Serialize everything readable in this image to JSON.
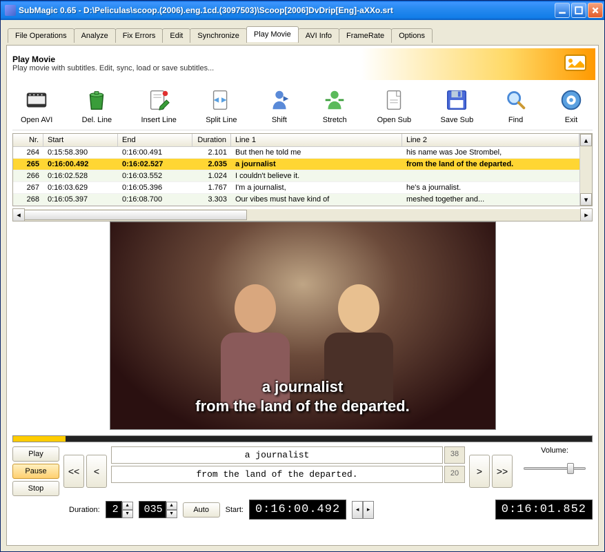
{
  "window": {
    "title": "SubMagic 0.65 - D:\\Peliculas\\scoop.(2006).eng.1cd.(3097503)\\Scoop[2006]DvDrip[Eng]-aXXo.srt"
  },
  "tabs": [
    {
      "label": "File Operations"
    },
    {
      "label": "Analyze"
    },
    {
      "label": "Fix Errors"
    },
    {
      "label": "Edit"
    },
    {
      "label": "Synchronize"
    },
    {
      "label": "Play Movie",
      "active": true
    },
    {
      "label": "AVI Info"
    },
    {
      "label": "FrameRate"
    },
    {
      "label": "Options"
    }
  ],
  "panel": {
    "title": "Play Movie",
    "subtitle": "Play movie with subtitles. Edit, sync, load or save subtitles..."
  },
  "toolbar": [
    {
      "name": "open-avi",
      "label": "Open AVI",
      "icon": "film"
    },
    {
      "name": "del-line",
      "label": "Del. Line",
      "icon": "trash"
    },
    {
      "name": "insert-line",
      "label": "Insert Line",
      "icon": "doc-pencil"
    },
    {
      "name": "split-line",
      "label": "Split Line",
      "icon": "doc-split"
    },
    {
      "name": "shift",
      "label": "Shift",
      "icon": "person-blue"
    },
    {
      "name": "stretch",
      "label": "Stretch",
      "icon": "person-green"
    },
    {
      "name": "open-sub",
      "label": "Open Sub",
      "icon": "doc"
    },
    {
      "name": "save-sub",
      "label": "Save Sub",
      "icon": "floppy"
    },
    {
      "name": "find",
      "label": "Find",
      "icon": "magnify"
    },
    {
      "name": "exit",
      "label": "Exit",
      "icon": "exit"
    }
  ],
  "grid": {
    "headers": {
      "nr": "Nr.",
      "start": "Start",
      "end": "End",
      "dur": "Duration",
      "l1": "Line 1",
      "l2": "Line 2"
    },
    "rows": [
      {
        "nr": "264",
        "start": "0:15:58.390",
        "end": "0:16:00.491",
        "dur": "2.101",
        "l1": "But then he told me",
        "l2": "his name was Joe Strombel,"
      },
      {
        "nr": "265",
        "start": "0:16:00.492",
        "end": "0:16:02.527",
        "dur": "2.035",
        "l1": "a journalist",
        "l2": "from the land of the departed.",
        "sel": true
      },
      {
        "nr": "266",
        "start": "0:16:02.528",
        "end": "0:16:03.552",
        "dur": "1.024",
        "l1": "I couldn't believe it.",
        "l2": "",
        "alt": true
      },
      {
        "nr": "267",
        "start": "0:16:03.629",
        "end": "0:16:05.396",
        "dur": "1.767",
        "l1": "I'm a journalist,",
        "l2": "he's a journalist."
      },
      {
        "nr": "268",
        "start": "0:16:05.397",
        "end": "0:16:08.700",
        "dur": "3.303",
        "l1": "Our vibes must have kind of",
        "l2": "meshed together and...",
        "alt": true
      }
    ]
  },
  "video_subtitle": {
    "l1": "a journalist",
    "l2": "from the land of the departed."
  },
  "playback": {
    "play": "Play",
    "pause": "Pause",
    "stop": "Stop",
    "prev_fast": "<<",
    "prev": "<",
    "next": ">",
    "next_fast": ">>",
    "line1": {
      "text": "a journalist",
      "chars": "38"
    },
    "line2": {
      "text": "from the land of the departed.",
      "chars": "20"
    },
    "volume_label": "Volume:"
  },
  "bottom": {
    "duration_label": "Duration:",
    "dur_sec": "2",
    "dur_ms": "035",
    "auto": "Auto",
    "start_label": "Start:",
    "start_time": "0:16:00.492",
    "current_time": "0:16:01.852"
  }
}
